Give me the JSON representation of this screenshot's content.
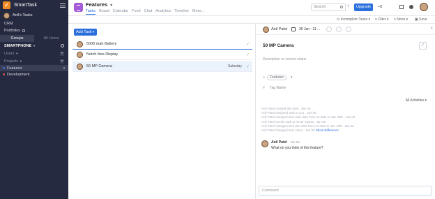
{
  "sidebar": {
    "brand": "SmartTask",
    "user": "Anil's Tasks",
    "nav": [
      "CRM",
      "Portfolios"
    ],
    "tabs": [
      "Groups",
      "All Users"
    ],
    "workspace": "SMARTPHONE",
    "sections": {
      "users": "Users",
      "projects": "Projects"
    },
    "projects": [
      {
        "name": "Features",
        "color": "#3b6fe0"
      },
      {
        "name": "Development",
        "color": "#d84b4b"
      }
    ]
  },
  "header": {
    "title": "Features",
    "view_tabs": [
      "Tasks",
      "Board",
      "Calendar",
      "Feed",
      "Chat",
      "Analytics",
      "Timeline",
      "More..."
    ],
    "search_placeholder": "Search",
    "help": "?",
    "upgrade": "Upgrade",
    "notif_count": "+8"
  },
  "filters": {
    "incomplete": "Incomplete Tasks",
    "filter": "Filter",
    "none": "None",
    "save": "Save"
  },
  "task_list": {
    "add_button": "Add Task",
    "tasks": [
      {
        "name": "5000 mah Battery",
        "date": "",
        "selected": false
      },
      {
        "name": "Notch-free Display",
        "date": "",
        "selected": false
      },
      {
        "name": "50 MP Camera",
        "date": "Saturday",
        "selected": true
      }
    ]
  },
  "detail": {
    "assignee": "Anil Patel",
    "date": "30 Jan - 11 ...",
    "title": "50 MP Camera",
    "description_placeholder": "Description or current status",
    "tag": "Features",
    "tag_name_placeholder": "Tag Name",
    "activity_filter": "All Activities",
    "activity": [
      "Anil Patel created this task . Jan 06",
      "Anil Patel assigned task to you . Jan 06",
      "Anil Patel changed task start date from no date to Jan 30th . Jan 06",
      "Anil Patel set the task to never repeat . Jan 06",
      "Anil Patel changed task due date from no date to Jan 11th . Jan 06",
      "Anil Patel changed task notes . Jan 06"
    ],
    "show_difference": "Show Difference",
    "comment": {
      "author": "Anil Patel",
      "time": "Jan 06",
      "text": "What do you think of this feature?"
    },
    "comment_placeholder": "Comment"
  }
}
